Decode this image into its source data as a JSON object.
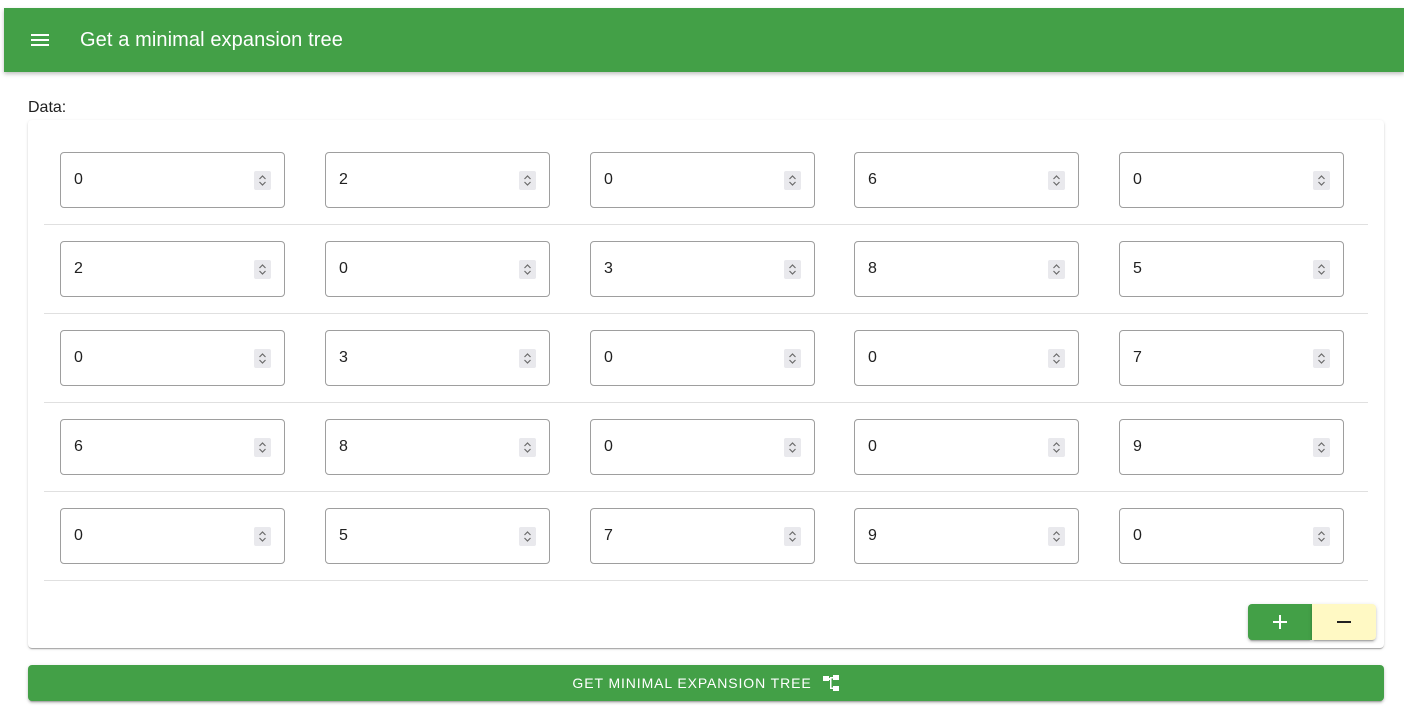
{
  "app_bar": {
    "title": "Get a minimal expansion tree",
    "menu_icon": "menu-icon",
    "color": "#43a047"
  },
  "data_section": {
    "label": "Data:",
    "matrix": [
      [
        "0",
        "2",
        "0",
        "6",
        "0"
      ],
      [
        "2",
        "0",
        "3",
        "8",
        "5"
      ],
      [
        "0",
        "3",
        "0",
        "0",
        "7"
      ],
      [
        "6",
        "8",
        "0",
        "0",
        "9"
      ],
      [
        "0",
        "5",
        "7",
        "9",
        "0"
      ]
    ],
    "add_button_icon": "plus-icon",
    "remove_button_icon": "minus-icon",
    "add_color": "#43a047",
    "remove_color": "#fff9c4"
  },
  "submit": {
    "label": "GET MINIMAL EXPANSION TREE",
    "icon": "tree-structure-icon"
  }
}
